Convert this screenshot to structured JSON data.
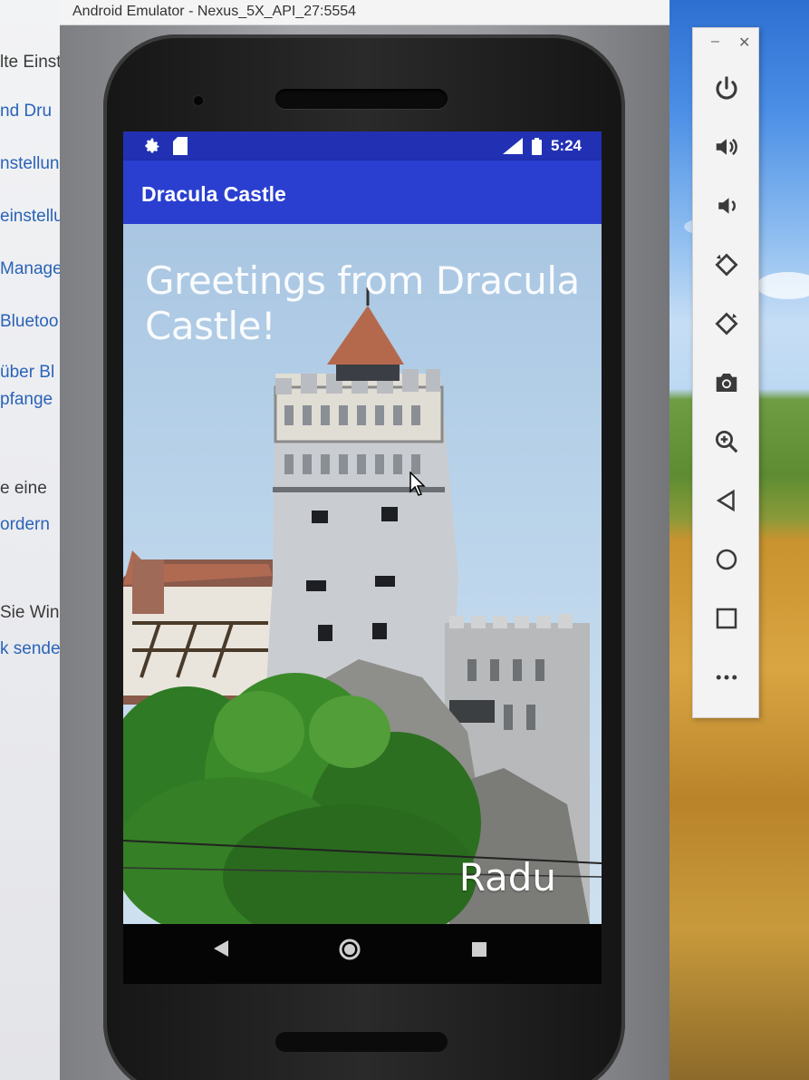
{
  "desktop": {
    "left_fragments": [
      {
        "text": "lte Einst",
        "color": "dark"
      },
      {
        "text": "nd Dru",
        "color": "blue"
      },
      {
        "text": "nstellun",
        "color": "blue"
      },
      {
        "text": "einstellu",
        "color": "blue"
      },
      {
        "text": "Manage",
        "color": "blue"
      },
      {
        "text": "Bluetoo",
        "color": "blue"
      },
      {
        "text": "über Bl",
        "color": "blue"
      },
      {
        "text": "pfange",
        "color": "blue"
      },
      {
        "text": "e eine",
        "color": "dark"
      },
      {
        "text": "ordern",
        "color": "blue"
      },
      {
        "text": "Sie Win",
        "color": "dark"
      },
      {
        "text": "k sende",
        "color": "blue"
      }
    ]
  },
  "window": {
    "title": "Android Emulator - Nexus_5X_API_27:5554"
  },
  "statusbar": {
    "time": "5:24",
    "icons_left": [
      "gear-icon",
      "sd-card-icon"
    ],
    "icons_right": [
      "signal-icon",
      "battery-icon"
    ]
  },
  "app": {
    "title": "Dracula Castle",
    "greeting": "Greetings from Dracula Castle!",
    "signature": "Radu",
    "colors": {
      "statusbar": "#2231b4",
      "appbar": "#2a3fd0"
    }
  },
  "navbar": {
    "buttons": [
      "back-icon",
      "home-icon",
      "recents-icon"
    ]
  },
  "toolbar": {
    "window_controls": [
      "minimize",
      "close"
    ],
    "buttons": [
      "power-icon",
      "volume-up-icon",
      "volume-down-icon",
      "rotate-left-icon",
      "rotate-right-icon",
      "camera-icon",
      "zoom-icon",
      "back-icon",
      "home-icon",
      "overview-icon",
      "more-icon"
    ]
  }
}
